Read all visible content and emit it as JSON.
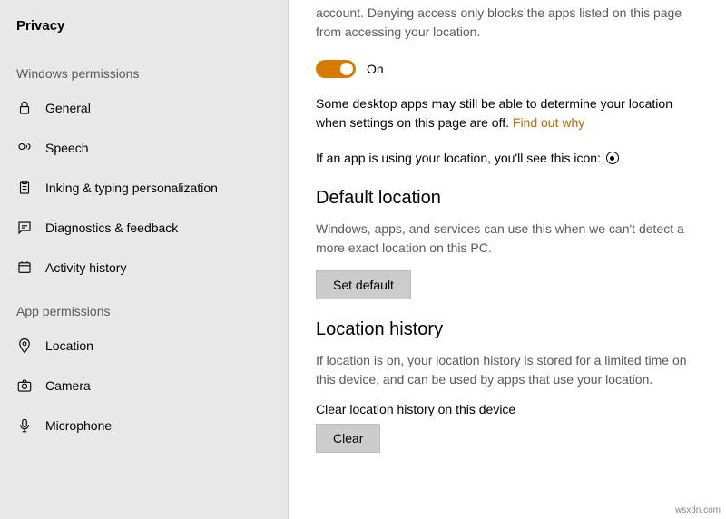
{
  "sidebar": {
    "title": "Privacy",
    "sections": {
      "windows": "Windows permissions",
      "app": "App permissions"
    },
    "items": {
      "general": "General",
      "speech": "Speech",
      "inking": "Inking & typing personalization",
      "diagnostics": "Diagnostics & feedback",
      "activity": "Activity history",
      "location": "Location",
      "camera": "Camera",
      "microphone": "Microphone"
    }
  },
  "content": {
    "intro": "account. Denying access only blocks the apps listed on this page from accessing your location.",
    "toggle_state": "On",
    "desktop_warn": "Some desktop apps may still be able to determine your location when settings on this page are off. ",
    "find_out": "Find out why",
    "using_text": "If an app is using your location, you'll see this icon:",
    "default_location": {
      "title": "Default location",
      "desc": "Windows, apps, and services can use this when we can't detect a more exact location on this PC.",
      "button": "Set default"
    },
    "history": {
      "title": "Location history",
      "desc": "If location is on, your location history is stored for a limited time on this device, and can be used by apps that use your location.",
      "sub": "Clear location history on this device",
      "button": "Clear"
    }
  },
  "watermark": "wsxdn.com"
}
